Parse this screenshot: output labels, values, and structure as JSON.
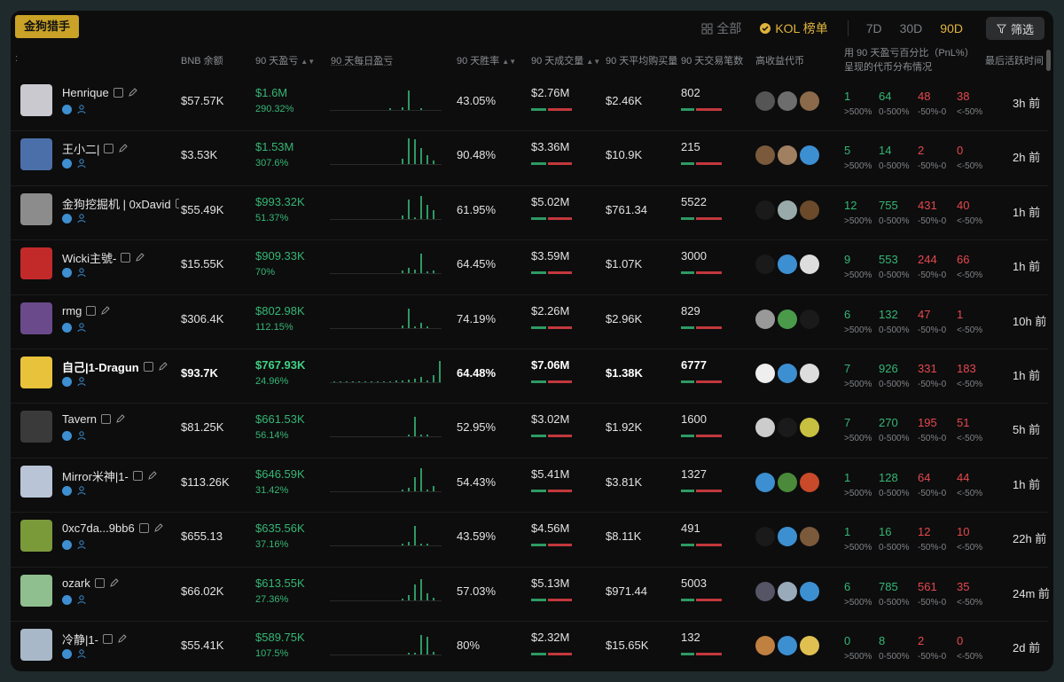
{
  "brand": "金狗猎手",
  "nav": {
    "all": "全部",
    "kol": "KOL 榜单",
    "filter": "筛选"
  },
  "timeframes": [
    "7D",
    "30D",
    "90D"
  ],
  "headers": {
    "bnb": "BNB 余额",
    "pnl": "90 天盈亏",
    "daily": "90 天每日盈亏",
    "winrate": "90 天胜率",
    "volume": "90 天成交量",
    "avgbuy": "90 天平均购买量",
    "trades": "90 天交易笔数",
    "tokens": "高收益代币",
    "dist": "用 90 天盈亏百分比（PnL%）呈现的代币分布情况",
    "last": "最后活跃时间"
  },
  "dist_labels": [
    ">500%",
    "0-500%",
    "-50%-0",
    "<-50%"
  ],
  "rows": [
    {
      "name": "Henrique",
      "bnb": "$57.57K",
      "pnl": "$1.6M",
      "pnl_pct": "290.32%",
      "winrate": "43.05%",
      "volume": "$2.76M",
      "avgbuy": "$2.46K",
      "trades": "802",
      "dist": [
        "1",
        "64",
        "48",
        "38"
      ],
      "last": "3h 前",
      "highlight": false,
      "avatar_color": "#c9c9cf"
    },
    {
      "name": "王小二|",
      "bnb": "$3.53K",
      "pnl": "$1.53M",
      "pnl_pct": "307.6%",
      "winrate": "90.48%",
      "volume": "$3.36M",
      "avgbuy": "$10.9K",
      "trades": "215",
      "dist": [
        "5",
        "14",
        "2",
        "0"
      ],
      "last": "2h 前",
      "highlight": false,
      "avatar_color": "#4b6fa8"
    },
    {
      "name": "金狗挖掘机 | 0xDavid",
      "bnb": "$55.49K",
      "pnl": "$993.32K",
      "pnl_pct": "51.37%",
      "winrate": "61.95%",
      "volume": "$5.02M",
      "avgbuy": "$761.34",
      "trades": "5522",
      "dist": [
        "12",
        "755",
        "431",
        "40"
      ],
      "last": "1h 前",
      "highlight": false,
      "avatar_color": "#8c8c8c"
    },
    {
      "name": "Wicki主號-",
      "bnb": "$15.55K",
      "pnl": "$909.33K",
      "pnl_pct": "70%",
      "winrate": "64.45%",
      "volume": "$3.59M",
      "avgbuy": "$1.07K",
      "trades": "3000",
      "dist": [
        "9",
        "553",
        "244",
        "66"
      ],
      "last": "1h 前",
      "highlight": false,
      "avatar_color": "#c22a2a"
    },
    {
      "name": "rmg",
      "bnb": "$306.4K",
      "pnl": "$802.98K",
      "pnl_pct": "112.15%",
      "winrate": "74.19%",
      "volume": "$2.26M",
      "avgbuy": "$2.96K",
      "trades": "829",
      "dist": [
        "6",
        "132",
        "47",
        "1"
      ],
      "last": "10h 前",
      "highlight": false,
      "avatar_color": "#6a4a8a"
    },
    {
      "name": "自己|1-Dragun",
      "bnb": "$93.7K",
      "pnl": "$767.93K",
      "pnl_pct": "24.96%",
      "winrate": "64.48%",
      "volume": "$7.06M",
      "avgbuy": "$1.38K",
      "trades": "6777",
      "dist": [
        "7",
        "926",
        "331",
        "183"
      ],
      "last": "1h 前",
      "highlight": true,
      "avatar_color": "#e8c23a"
    },
    {
      "name": "Tavern",
      "bnb": "$81.25K",
      "pnl": "$661.53K",
      "pnl_pct": "56.14%",
      "winrate": "52.95%",
      "volume": "$3.02M",
      "avgbuy": "$1.92K",
      "trades": "1600",
      "dist": [
        "7",
        "270",
        "195",
        "51"
      ],
      "last": "5h 前",
      "highlight": false,
      "avatar_color": "#3a3a3a"
    },
    {
      "name": "Mirror米神|1-",
      "bnb": "$113.26K",
      "pnl": "$646.59K",
      "pnl_pct": "31.42%",
      "winrate": "54.43%",
      "volume": "$5.41M",
      "avgbuy": "$3.81K",
      "trades": "1327",
      "dist": [
        "1",
        "128",
        "64",
        "44"
      ],
      "last": "1h 前",
      "highlight": false,
      "avatar_color": "#b9c4d6"
    },
    {
      "name": "0xc7da...9bb6",
      "bnb": "$655.13",
      "pnl": "$635.56K",
      "pnl_pct": "37.16%",
      "winrate": "43.59%",
      "volume": "$4.56M",
      "avgbuy": "$8.11K",
      "trades": "491",
      "dist": [
        "1",
        "16",
        "12",
        "10"
      ],
      "last": "22h 前",
      "highlight": false,
      "avatar_color": "#7a9a3a"
    },
    {
      "name": "ozark",
      "bnb": "$66.02K",
      "pnl": "$613.55K",
      "pnl_pct": "27.36%",
      "winrate": "57.03%",
      "volume": "$5.13M",
      "avgbuy": "$971.44",
      "trades": "5003",
      "dist": [
        "6",
        "785",
        "561",
        "35"
      ],
      "last": "24m 前",
      "highlight": false,
      "avatar_color": "#8fbf8f"
    },
    {
      "name": "冷静|1-",
      "bnb": "$55.41K",
      "pnl": "$589.75K",
      "pnl_pct": "107.5%",
      "winrate": "80%",
      "volume": "$2.32M",
      "avgbuy": "$15.65K",
      "trades": "132",
      "dist": [
        "0",
        "8",
        "2",
        "0"
      ],
      "last": "2d 前",
      "highlight": false,
      "avatar_color": "#a8b8c8"
    }
  ],
  "colors": {
    "gain": "#35b673",
    "loss": "#e6484c",
    "accent": "#e0b43c",
    "brand": "#c9a227"
  }
}
